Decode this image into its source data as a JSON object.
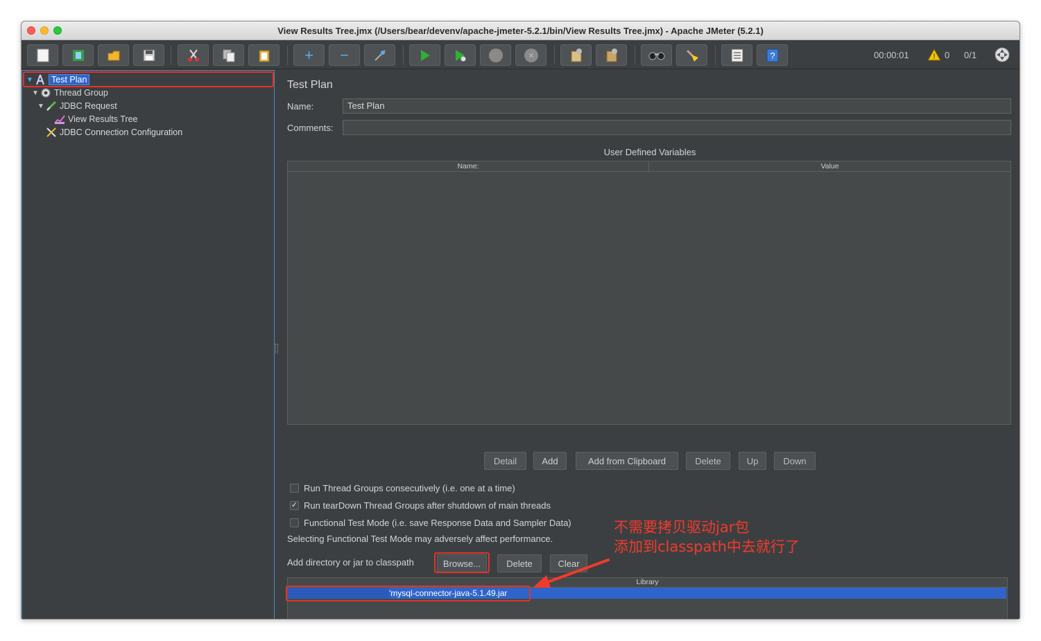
{
  "window": {
    "title": "View Results Tree.jmx (/Users/bear/devenv/apache-jmeter-5.2.1/bin/View Results Tree.jmx) - Apache JMeter (5.2.1)"
  },
  "toolbar": {
    "buttons": [
      "new-icon",
      "templates-icon",
      "open-icon",
      "save-icon",
      "cut-icon",
      "copy-icon",
      "paste-icon",
      "expand-icon",
      "collapse-icon",
      "toggle-icon",
      "start-icon",
      "start-no-pause-icon",
      "stop-icon",
      "shutdown-icon",
      "clear-icon",
      "clear-all-icon",
      "search-icon",
      "reset-search-icon",
      "function-helper-icon",
      "help-icon"
    ],
    "elapsed_time": "00:00:01",
    "warning_count": "0",
    "active_threads": "0/1"
  },
  "tree": {
    "items": [
      {
        "label": "Test Plan",
        "icon": "test-plan-icon",
        "selected": true
      },
      {
        "label": "Thread Group",
        "icon": "gear-icon"
      },
      {
        "label": "JDBC Request",
        "icon": "pipette-icon"
      },
      {
        "label": "View Results Tree",
        "icon": "graph-icon"
      },
      {
        "label": "JDBC Connection Configuration",
        "icon": "wrench-icon"
      }
    ]
  },
  "test_plan": {
    "section_title": "Test Plan",
    "name_label": "Name:",
    "name_value": "Test Plan",
    "comments_label": "Comments:",
    "comments_value": "",
    "udv_title": "User Defined Variables",
    "udv_columns": [
      "Name:",
      "Value"
    ],
    "udv_buttons": [
      "Detail",
      "Add",
      "Add from Clipboard",
      "Delete",
      "Up",
      "Down"
    ],
    "options": [
      {
        "label": "Run Thread Groups consecutively (i.e. one at a time)",
        "checked": false
      },
      {
        "label": "Run tearDown Thread Groups after shutdown of main threads",
        "checked": true
      },
      {
        "label": "Functional Test Mode (i.e. save Response Data and Sampler Data)",
        "checked": false
      }
    ],
    "functional_note": "Selecting Functional Test Mode may adversely affect performance.",
    "classpath_label": "Add directory or jar to classpath",
    "classpath_buttons": [
      "Browse...",
      "Delete",
      "Clear"
    ],
    "library_column": "Library",
    "library_rows": [
      "'mysql-connector-java-5.1.49.jar"
    ]
  },
  "annotation": {
    "line1": "不需要拷贝驱动jar包",
    "line2": "添加到classpath中去就行了",
    "color": "#f23a2c"
  },
  "colors": {
    "background": "#3c3f41",
    "selection": "#2f65ca",
    "highlight_red": "#e2332a"
  }
}
